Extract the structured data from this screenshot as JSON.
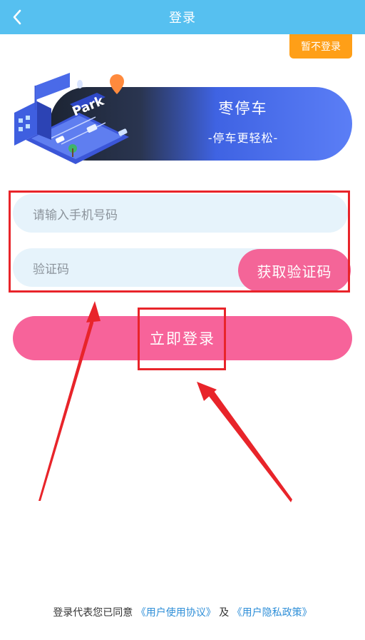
{
  "header": {
    "title": "登录",
    "back_icon": "chevron-left-icon"
  },
  "skip_button": {
    "label": "暂不登录"
  },
  "banner": {
    "title": "枣停车",
    "subtitle": "-停车更轻松-",
    "illustration_text": "Park"
  },
  "form": {
    "phone_placeholder": "请输入手机号码",
    "code_placeholder": "验证码",
    "get_code_label": "获取验证码",
    "login_label": "立即登录"
  },
  "agreement": {
    "prefix": "登录代表您已同意",
    "user_agreement": "《用户使用协议》",
    "conjunction": "及",
    "privacy_policy": "《用户隐私政策》"
  },
  "colors": {
    "header": "#56c0f0",
    "skip_button": "#ff9f17",
    "primary_pink": "#f7639a",
    "field_bg": "#e6f3fb",
    "link": "#2f8fd8",
    "annotation_red": "#e8242a"
  }
}
